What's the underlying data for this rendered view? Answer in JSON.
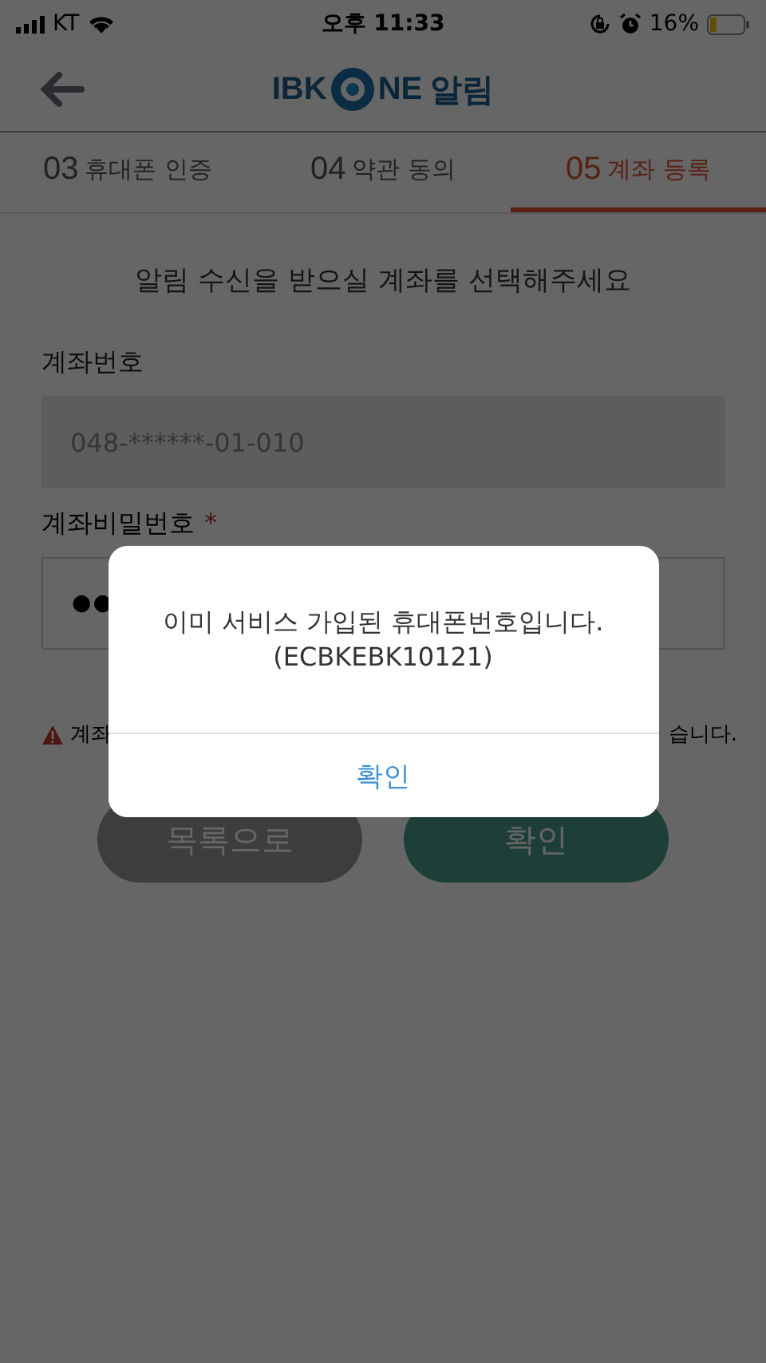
{
  "status_bar": {
    "carrier": "KT",
    "time": "오후 11:33",
    "battery": "16%"
  },
  "header": {
    "logo_text": "IBK",
    "logo_text_2": "NE",
    "logo_suffix": "알림"
  },
  "tabs": [
    {
      "number": "03",
      "label": "휴대폰 인증",
      "selected": false
    },
    {
      "number": "04",
      "label": "약관 동의",
      "selected": false
    },
    {
      "number": "05",
      "label": "계좌 등록",
      "selected": true
    }
  ],
  "prompt": "알림 수신을 받으실 계좌를 선택해주세요",
  "account": {
    "label": "계좌번호",
    "value": "048-******-01-010"
  },
  "password": {
    "label": "계좌비밀번호",
    "required_mark": "*",
    "value": "●●"
  },
  "warning": {
    "start": "계좌",
    "end": "습니다."
  },
  "buttons": [
    {
      "label": "목록으로",
      "kind": "secondary"
    },
    {
      "label": "확인",
      "kind": "primary"
    }
  ],
  "dialog": {
    "message": "이미 서비스 가입된 휴대폰번호입니다.",
    "code": "(ECBKEBK10121)",
    "button": "확인"
  }
}
